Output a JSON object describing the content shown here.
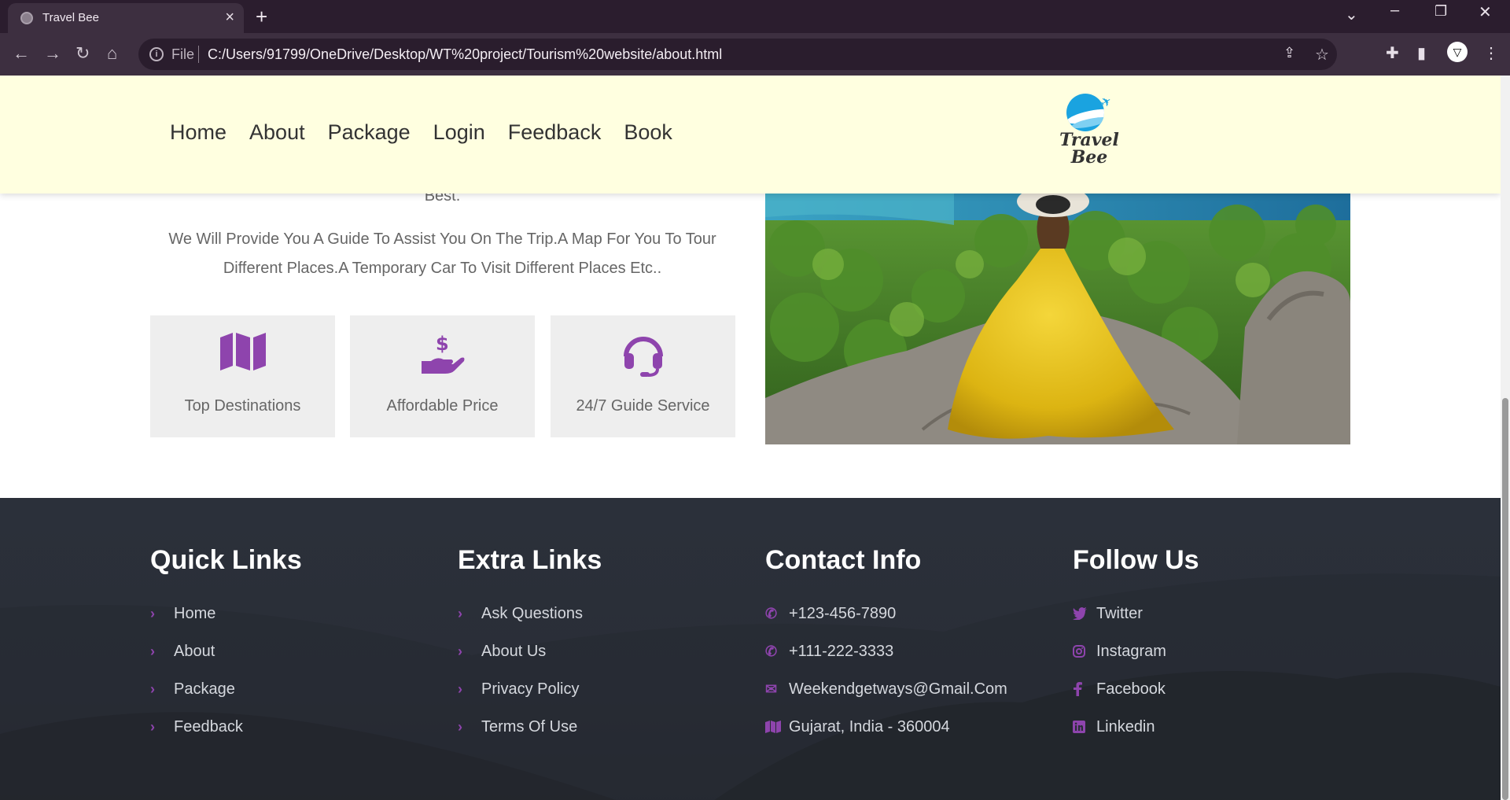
{
  "browser": {
    "tab_title": "Travel Bee",
    "omnibox_scheme": "File",
    "url": "C:/Users/91799/OneDrive/Desktop/WT%20project/Tourism%20website/about.html"
  },
  "header": {
    "nav": [
      "Home",
      "About",
      "Package",
      "Login",
      "Feedback",
      "Book"
    ],
    "logo_line1": "Travel",
    "logo_line2": "Bee"
  },
  "about": {
    "cut_text": "Best.",
    "paragraph": "We Will Provide You A Guide To Assist You On The Trip.A Map For You To Tour Different Places.A Temporary Car To Visit Different Places Etc..",
    "features": [
      {
        "label": "Top Destinations",
        "icon": "map-icon"
      },
      {
        "label": "Affordable Price",
        "icon": "hand-dollar-icon"
      },
      {
        "label": "24/7 Guide Service",
        "icon": "headset-icon"
      }
    ]
  },
  "footer": {
    "quick_links": {
      "title": "Quick Links",
      "items": [
        "Home",
        "About",
        "Package",
        "Feedback"
      ]
    },
    "extra_links": {
      "title": "Extra Links",
      "items": [
        "Ask Questions",
        "About Us",
        "Privacy Policy",
        "Terms Of Use"
      ]
    },
    "contact_info": {
      "title": "Contact Info",
      "items": [
        "+123-456-7890",
        "+111-222-3333",
        "Weekendgetways@Gmail.Com",
        "Gujarat, India - 360004"
      ]
    },
    "follow_us": {
      "title": "Follow Us",
      "items": [
        "Twitter",
        "Instagram",
        "Facebook",
        "Linkedin"
      ]
    }
  },
  "colors": {
    "accent": "#8e44ad",
    "header_bg": "#ffffe0",
    "footer_bg": "#2b303a",
    "feature_bg": "#eeeeee"
  }
}
